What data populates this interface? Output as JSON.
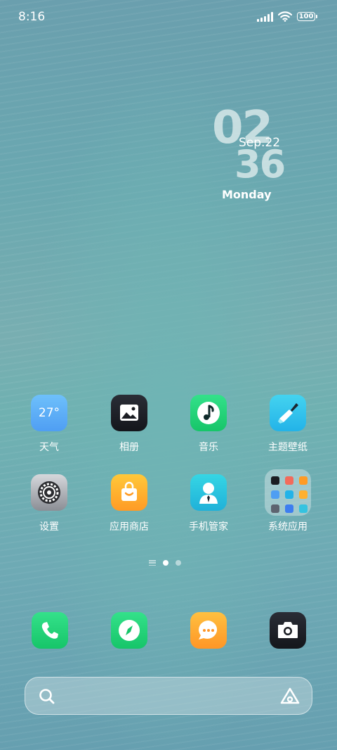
{
  "status_bar": {
    "time": "8:16",
    "battery": "100"
  },
  "clock_widget": {
    "hour": "02",
    "minute": "36",
    "date": "Sep.22",
    "weekday": "Monday"
  },
  "apps": [
    {
      "label": "天气",
      "icon": "weather-icon",
      "temp": "27°"
    },
    {
      "label": "相册",
      "icon": "gallery-icon"
    },
    {
      "label": "音乐",
      "icon": "music-icon"
    },
    {
      "label": "主题壁纸",
      "icon": "theme-brush-icon"
    },
    {
      "label": "设置",
      "icon": "gear-icon"
    },
    {
      "label": "应用商店",
      "icon": "shopping-bag-icon"
    },
    {
      "label": "手机管家",
      "icon": "phone-manager-icon"
    },
    {
      "label": "系统应用",
      "icon": "folder-icon"
    }
  ],
  "page_indicator": {
    "pages": 2,
    "active": 1
  },
  "dock": [
    {
      "icon": "phone-icon"
    },
    {
      "icon": "compass-icon"
    },
    {
      "icon": "message-icon"
    },
    {
      "icon": "camera-icon"
    }
  ],
  "search": {
    "placeholder": ""
  },
  "colors": {
    "green": "#16c569",
    "blue": "#4f9ef3",
    "orange": "#ff9b25",
    "dark": "#14161b"
  }
}
